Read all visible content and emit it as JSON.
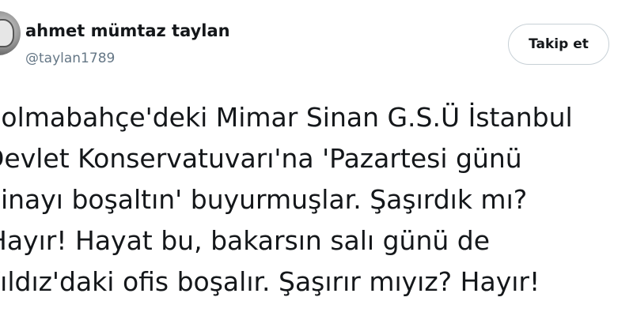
{
  "author": {
    "name": "ahmet mümtaz taylan",
    "handle": "@taylan1789",
    "avatar_icon": "profile-photo"
  },
  "follow_button": {
    "label": "Takip et"
  },
  "tweet": {
    "lines": [
      "Dolmabahçe'deki Mimar Sinan G.S.Ü İstanbul",
      "Devlet Konservatuvarı'na 'Pazartesi günü",
      "binayı boşaltın' buyurmuşlar. Şaşırdık mı?",
      "Hayır! Hayat bu, bakarsın salı günü de",
      "Yıldız'daki ofis boşalır. Şaşırır mıyız? Hayır!"
    ]
  },
  "colors": {
    "text": "#14171a",
    "secondary_text": "#657786",
    "button_border": "#c7d0d6"
  }
}
